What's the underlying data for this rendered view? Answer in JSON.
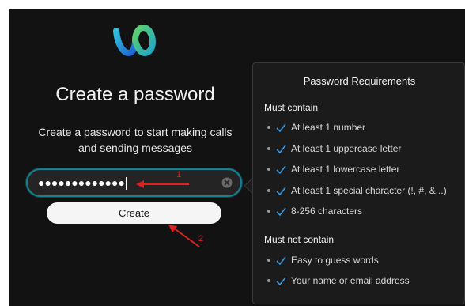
{
  "brand": {
    "logo_icon": "webex-logo-icon",
    "colors": {
      "logo_teal": "#2fc2d8",
      "logo_blue": "#1f5fd6",
      "logo_green": "#5fd06a",
      "field_border": "#1a7e8f",
      "annotation_red": "#e02020",
      "check_blue": "#3a9ee8"
    }
  },
  "form": {
    "title": "Create a password",
    "subtitle_line1": "Create a password to start making calls",
    "subtitle_line2": "and sending messages",
    "password_value": "●●●●●●●●●●●●●",
    "clear_icon": "clear-circle-icon",
    "create_label": "Create"
  },
  "annotations": {
    "label_1": "1",
    "label_2": "2"
  },
  "requirements": {
    "title": "Password Requirements",
    "must_contain_heading": "Must contain",
    "must_contain": [
      {
        "text": "At least 1 number",
        "icon": "check-icon"
      },
      {
        "text": "At least 1 uppercase letter",
        "icon": "check-icon"
      },
      {
        "text": "At least 1 lowercase letter",
        "icon": "check-icon"
      },
      {
        "text": "At least 1 special character (!, #, &...)",
        "icon": "check-icon"
      },
      {
        "text": "8-256 characters",
        "icon": "check-icon"
      }
    ],
    "must_not_contain_heading": "Must not contain",
    "must_not_contain": [
      {
        "text": "Easy to guess words",
        "icon": "check-icon"
      },
      {
        "text": "Your name or email address",
        "icon": "check-icon"
      }
    ]
  }
}
